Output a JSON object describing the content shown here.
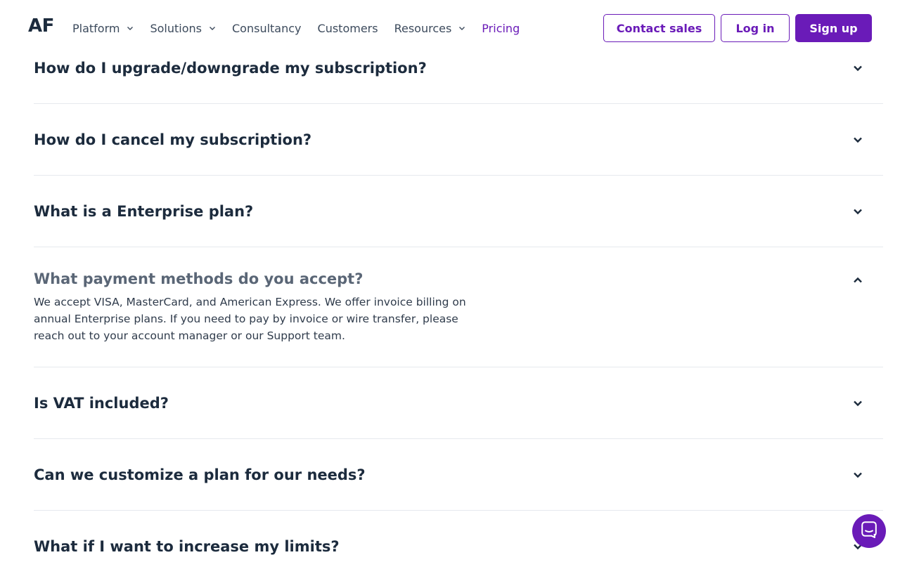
{
  "header": {
    "logo": "AF",
    "nav": [
      {
        "label": "Platform",
        "has_dropdown": true
      },
      {
        "label": "Solutions",
        "has_dropdown": true
      },
      {
        "label": "Consultancy",
        "has_dropdown": false
      },
      {
        "label": "Customers",
        "has_dropdown": false
      },
      {
        "label": "Resources",
        "has_dropdown": true
      },
      {
        "label": "Pricing",
        "has_dropdown": false,
        "active": true
      }
    ],
    "contact_sales": "Contact sales",
    "login": "Log in",
    "signup": "Sign up"
  },
  "faq": [
    {
      "question": "How do I upgrade/downgrade my subscription?",
      "open": false
    },
    {
      "question": "How do I cancel my subscription?",
      "open": false
    },
    {
      "question": "What is a Enterprise plan?",
      "open": false
    },
    {
      "question": "What payment methods do you accept?",
      "open": true,
      "answer": "We accept VISA, MasterCard, and American Express. We offer invoice billing on annual Enterprise plans. If you need to pay by invoice or wire transfer, please reach out to your account manager or our Support team."
    },
    {
      "question": "Is VAT included?",
      "open": false
    },
    {
      "question": "Can we customize a plan for our needs?",
      "open": false
    },
    {
      "question": "What if I want to increase my limits?",
      "open": false
    }
  ],
  "colors": {
    "accent": "#6a1bb8",
    "text": "#1c2b3d",
    "divider": "#e6e9ee"
  },
  "icons": {
    "faq_closed": "chevron-down-icon",
    "faq_open": "chevron-up-icon",
    "chat": "chat-bubble-icon"
  }
}
